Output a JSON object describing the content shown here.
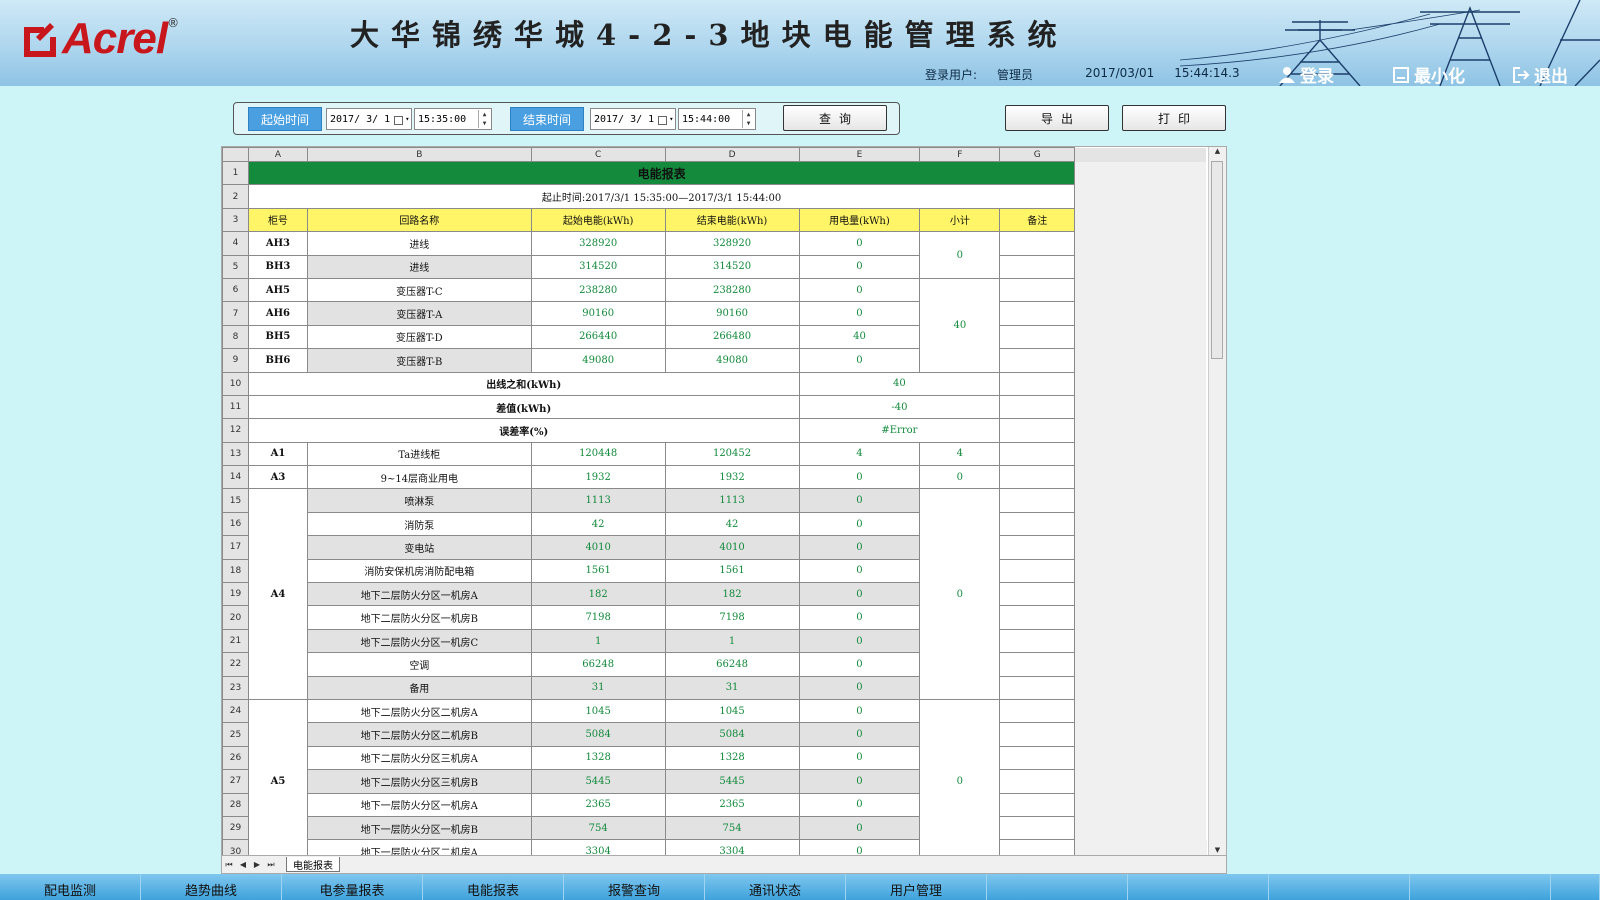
{
  "header": {
    "logo_text": "Acrel",
    "logo_reg": "®",
    "title": "大华锦绣华城4-2-3地块电能管理系统",
    "user_label": "登录用户:",
    "user_name": "管理员",
    "date": "2017/03/01",
    "time": "15:44:14.3",
    "login": "登录",
    "minimize": "最小化",
    "exit": "退出"
  },
  "toolbar": {
    "start_label": "起始时间",
    "start_date": "2017/ 3/ 1",
    "start_time": "15:35:00",
    "end_label": "结束时间",
    "end_date": "2017/ 3/ 1",
    "end_time": "15:44:00",
    "query": "查询",
    "export": "导出",
    "print": "打印"
  },
  "sheet": {
    "col_letters": [
      "A",
      "B",
      "C",
      "D",
      "E",
      "F",
      "G"
    ],
    "row_numbers": [
      "1",
      "2",
      "3",
      "4",
      "5",
      "6",
      "7",
      "8",
      "9",
      "10",
      "11",
      "12",
      "13",
      "14",
      "15",
      "16",
      "17",
      "18",
      "19",
      "20",
      "21",
      "22",
      "23",
      "24",
      "25",
      "26",
      "27",
      "28",
      "29",
      "30"
    ],
    "title": "电能报表",
    "period": "起止时间:2017/3/1 15:35:00—2017/3/1 15:44:00",
    "headers": [
      "柜号",
      "回路名称",
      "起始电能(kWh)",
      "结束电能(kWh)",
      "用电量(kWh)",
      "小计",
      "备注"
    ],
    "group1": [
      {
        "cab": "AH3",
        "name": "进线",
        "start": "328920",
        "end": "328920",
        "usage": "0"
      },
      {
        "cab": "BH3",
        "name": "进线",
        "start": "314520",
        "end": "314520",
        "usage": "0"
      }
    ],
    "group1_sub": "0",
    "group2": [
      {
        "cab": "AH5",
        "name": "变压器T-C",
        "start": "238280",
        "end": "238280",
        "usage": "0"
      },
      {
        "cab": "AH6",
        "name": "变压器T-A",
        "start": "90160",
        "end": "90160",
        "usage": "0"
      },
      {
        "cab": "BH5",
        "name": "变压器T-D",
        "start": "266440",
        "end": "266480",
        "usage": "40"
      },
      {
        "cab": "BH6",
        "name": "变压器T-B",
        "start": "49080",
        "end": "49080",
        "usage": "0"
      }
    ],
    "group2_sub": "40",
    "summary": [
      {
        "label": "出线之和(kWh)",
        "value": "40"
      },
      {
        "label": "差值(kWh)",
        "value": "-40"
      },
      {
        "label": "误差率(%)",
        "value": "#Error"
      }
    ],
    "a1": {
      "cab": "A1",
      "name": "Ta进线柜",
      "start": "120448",
      "end": "120452",
      "usage": "4",
      "sub": "4"
    },
    "a3": {
      "cab": "A3",
      "name": "9~14层商业用电",
      "start": "1932",
      "end": "1932",
      "usage": "0",
      "sub": "0"
    },
    "a4_cab": "A4",
    "a4_sub": "0",
    "a4": [
      {
        "name": "喷淋泵",
        "start": "1113",
        "end": "1113",
        "usage": "0"
      },
      {
        "name": "消防泵",
        "start": "42",
        "end": "42",
        "usage": "0"
      },
      {
        "name": "变电站",
        "start": "4010",
        "end": "4010",
        "usage": "0"
      },
      {
        "name": "消防安保机房消防配电箱",
        "start": "1561",
        "end": "1561",
        "usage": "0"
      },
      {
        "name": "地下二层防火分区一机房A",
        "start": "182",
        "end": "182",
        "usage": "0"
      },
      {
        "name": "地下二层防火分区一机房B",
        "start": "7198",
        "end": "7198",
        "usage": "0"
      },
      {
        "name": "地下二层防火分区一机房C",
        "start": "1",
        "end": "1",
        "usage": "0"
      },
      {
        "name": "空调",
        "start": "66248",
        "end": "66248",
        "usage": "0"
      },
      {
        "name": "备用",
        "start": "31",
        "end": "31",
        "usage": "0"
      }
    ],
    "a5_cab": "A5",
    "a5_sub": "0",
    "a5": [
      {
        "name": "地下二层防火分区二机房A",
        "start": "1045",
        "end": "1045",
        "usage": "0"
      },
      {
        "name": "地下二层防火分区二机房B",
        "start": "5084",
        "end": "5084",
        "usage": "0"
      },
      {
        "name": "地下二层防火分区三机房A",
        "start": "1328",
        "end": "1328",
        "usage": "0"
      },
      {
        "name": "地下二层防火分区三机房B",
        "start": "5445",
        "end": "5445",
        "usage": "0"
      },
      {
        "name": "地下一层防火分区一机房A",
        "start": "2365",
        "end": "2365",
        "usage": "0"
      },
      {
        "name": "地下一层防火分区一机房B",
        "start": "754",
        "end": "754",
        "usage": "0"
      },
      {
        "name": "地下一层防火分区二机房A",
        "start": "3304",
        "end": "3304",
        "usage": "0"
      }
    ],
    "tab_name": "电能报表"
  },
  "nav": [
    "配电监测",
    "趋势曲线",
    "电参量报表",
    "电能报表",
    "报警查询",
    "通讯状态",
    "用户管理",
    "",
    "",
    "",
    "",
    ""
  ]
}
